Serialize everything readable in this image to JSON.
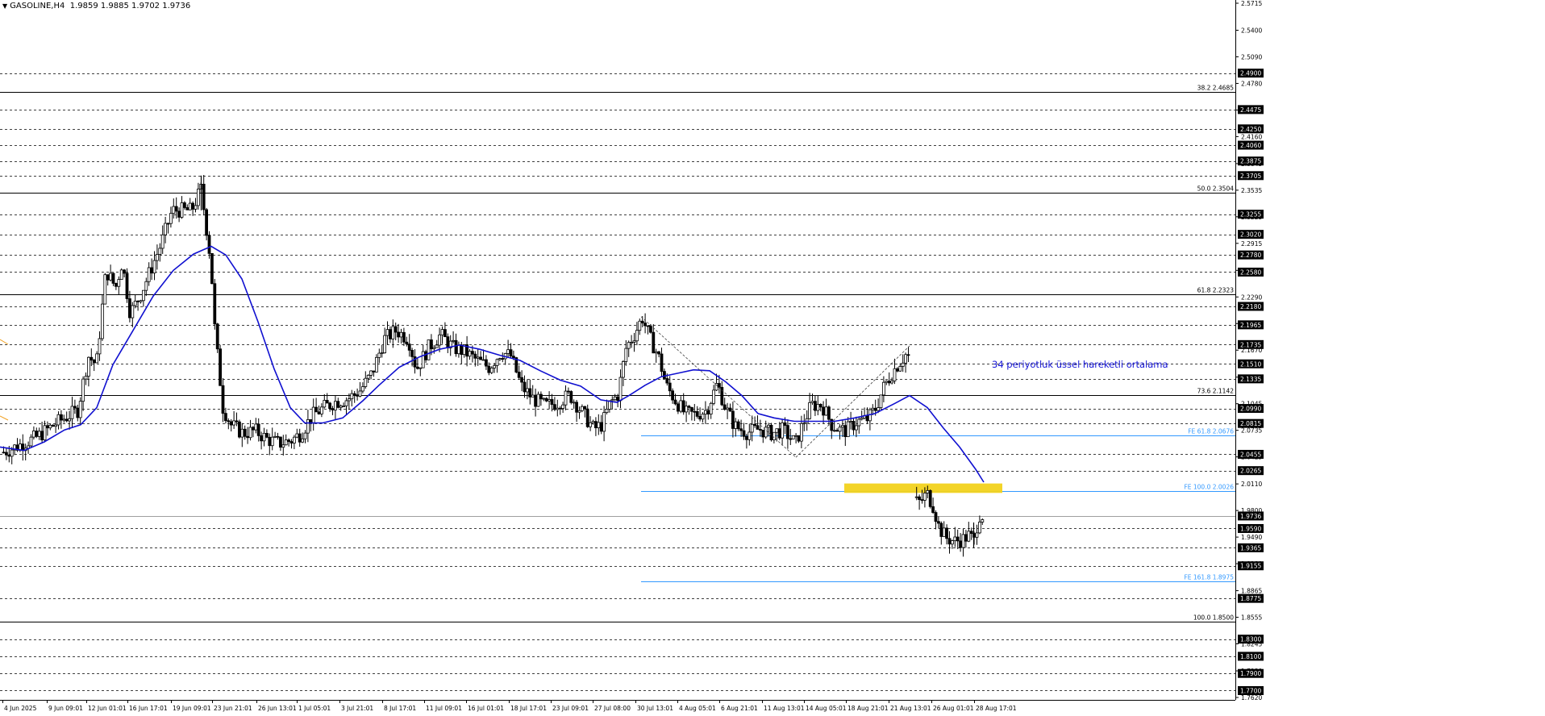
{
  "header": {
    "symbol": "GASOLINE,H4",
    "ohlc": "1.9859 1.9885 1.9702 1.9736"
  },
  "annotation": "34 periyotluk üssel hareketli ortalama",
  "colors": {
    "background": "#ffffff",
    "candle": "#000000",
    "ema": "#1010d0",
    "fibo_line": "#000000",
    "fe_line": "#3399ff",
    "zone": "#f2d21c",
    "grid": "#000000",
    "price_tag_bg": "#000000",
    "price_tag_text": "#ffffff",
    "marker": "#f0a020"
  },
  "chart_data": {
    "type": "candlestick",
    "symbol": "GASOLINE",
    "timeframe": "H4",
    "ylim": [
      1.76,
      2.5715
    ],
    "y_ticks": [
      "2.5715",
      "2.5400",
      "2.5090",
      "2.4780",
      "2.4470",
      "2.4160",
      "2.3845",
      "2.3535",
      "2.3225",
      "2.2915",
      "2.2600",
      "2.2290",
      "2.1980",
      "2.1670",
      "2.1355",
      "2.1045",
      "2.0735",
      "2.0425",
      "2.0110",
      "1.9800",
      "1.9490",
      "1.9180",
      "1.8865",
      "1.8555",
      "1.8245",
      "1.7930",
      "1.7620"
    ],
    "x_labels": [
      "4 Jun 2025",
      "9 Jun 09:01",
      "12 Jun 01:01",
      "16 Jun 17:01",
      "19 Jun 09:01",
      "23 Jun 21:01",
      "26 Jun 13:01",
      "1 Jul 05:01",
      "3 Jul 21:01",
      "8 Jul 17:01",
      "11 Jul 09:01",
      "16 Jul 01:01",
      "18 Jul 17:01",
      "23 Jul 09:01",
      "27 Jul 08:00",
      "30 Jul 13:01",
      "4 Aug 05:01",
      "6 Aug 21:01",
      "11 Aug 13:01",
      "14 Aug 05:01",
      "18 Aug 21:01",
      "21 Aug 13:01",
      "26 Aug 01:01",
      "28 Aug 17:01"
    ],
    "dashed_levels": [
      {
        "price": 2.49,
        "label": "2.4900"
      },
      {
        "price": 2.4475,
        "label": "2.4475"
      },
      {
        "price": 2.425,
        "label": "2.4250"
      },
      {
        "price": 2.406,
        "label": "2.4060"
      },
      {
        "price": 2.3875,
        "label": "2.3875"
      },
      {
        "price": 2.3705,
        "label": "2.3705"
      },
      {
        "price": 2.3255,
        "label": "2.3255"
      },
      {
        "price": 2.302,
        "label": "2.3020"
      },
      {
        "price": 2.278,
        "label": "2.2780"
      },
      {
        "price": 2.258,
        "label": "2.2580"
      },
      {
        "price": 2.218,
        "label": "2.2180"
      },
      {
        "price": 2.1965,
        "label": "2.1965"
      },
      {
        "price": 2.1735,
        "label": "2.1735"
      },
      {
        "price": 2.151,
        "label": "2.1510"
      },
      {
        "price": 2.1335,
        "label": "2.1335"
      },
      {
        "price": 2.099,
        "label": "2.0990"
      },
      {
        "price": 2.0815,
        "label": "2.0815"
      },
      {
        "price": 2.0455,
        "label": "2.0455"
      },
      {
        "price": 2.0265,
        "label": "2.0265"
      },
      {
        "price": 1.959,
        "label": "1.9590"
      },
      {
        "price": 1.9365,
        "label": "1.9365"
      },
      {
        "price": 1.9155,
        "label": "1.9155"
      },
      {
        "price": 1.8775,
        "label": "1.8775"
      },
      {
        "price": 1.83,
        "label": "1.8300"
      },
      {
        "price": 1.81,
        "label": "1.8100"
      },
      {
        "price": 1.79,
        "label": "1.7900"
      },
      {
        "price": 1.77,
        "label": "1.7700"
      }
    ],
    "fibo_levels": [
      {
        "price": 2.4685,
        "label": "38.2 2.4685"
      },
      {
        "price": 2.3504,
        "label": "50.0 2.3504"
      },
      {
        "price": 2.2323,
        "label": "61.8 2.2323"
      },
      {
        "price": 2.1142,
        "label": "73.6 2.1142"
      },
      {
        "price": 1.85,
        "label": "100.0 1.8500"
      }
    ],
    "fe_levels": [
      {
        "price": 2.0676,
        "label": "FE 61.8 2.0676"
      },
      {
        "price": 2.0026,
        "label": "FE 100.0 2.0026"
      },
      {
        "price": 1.8975,
        "label": "FE 161.8 1.8975"
      }
    ],
    "current_price": {
      "price": 1.9736,
      "label": "1.9736"
    },
    "zone": {
      "from": 2.0005,
      "to": 2.0115
    },
    "ema_label": "34 periyotluk üssel hareketli ortalama",
    "ema_points": [
      [
        0,
        2.054
      ],
      [
        30,
        2.05
      ],
      [
        55,
        2.06
      ],
      [
        80,
        2.074
      ],
      [
        100,
        2.08
      ],
      [
        120,
        2.1
      ],
      [
        140,
        2.15
      ],
      [
        165,
        2.19
      ],
      [
        190,
        2.23
      ],
      [
        215,
        2.26
      ],
      [
        240,
        2.279
      ],
      [
        262,
        2.288
      ],
      [
        280,
        2.278
      ],
      [
        300,
        2.25
      ],
      [
        320,
        2.2
      ],
      [
        340,
        2.145
      ],
      [
        360,
        2.1
      ],
      [
        378,
        2.082
      ],
      [
        400,
        2.082
      ],
      [
        425,
        2.088
      ],
      [
        450,
        2.108
      ],
      [
        470,
        2.126
      ],
      [
        495,
        2.147
      ],
      [
        520,
        2.159
      ],
      [
        545,
        2.168
      ],
      [
        570,
        2.173
      ],
      [
        595,
        2.168
      ],
      [
        620,
        2.161
      ],
      [
        645,
        2.155
      ],
      [
        670,
        2.143
      ],
      [
        695,
        2.132
      ],
      [
        720,
        2.125
      ],
      [
        745,
        2.109
      ],
      [
        765,
        2.106
      ],
      [
        780,
        2.114
      ],
      [
        800,
        2.126
      ],
      [
        820,
        2.136
      ],
      [
        840,
        2.14
      ],
      [
        860,
        2.144
      ],
      [
        880,
        2.143
      ],
      [
        900,
        2.13
      ],
      [
        920,
        2.114
      ],
      [
        940,
        2.093
      ],
      [
        960,
        2.088
      ],
      [
        985,
        2.084
      ],
      [
        1010,
        2.084
      ],
      [
        1035,
        2.084
      ],
      [
        1060,
        2.088
      ],
      [
        1085,
        2.093
      ],
      [
        1110,
        2.105
      ],
      [
        1128,
        2.114
      ],
      [
        1150,
        2.1
      ],
      [
        1170,
        2.076
      ],
      [
        1190,
        2.054
      ],
      [
        1210,
        2.028
      ],
      [
        1220,
        2.013
      ]
    ],
    "candles_summary": {
      "high": {
        "price": 2.3705,
        "near": "19 Jun 09:01"
      },
      "low": {
        "price": 1.9365,
        "near": "26 Aug 01:01"
      }
    }
  }
}
